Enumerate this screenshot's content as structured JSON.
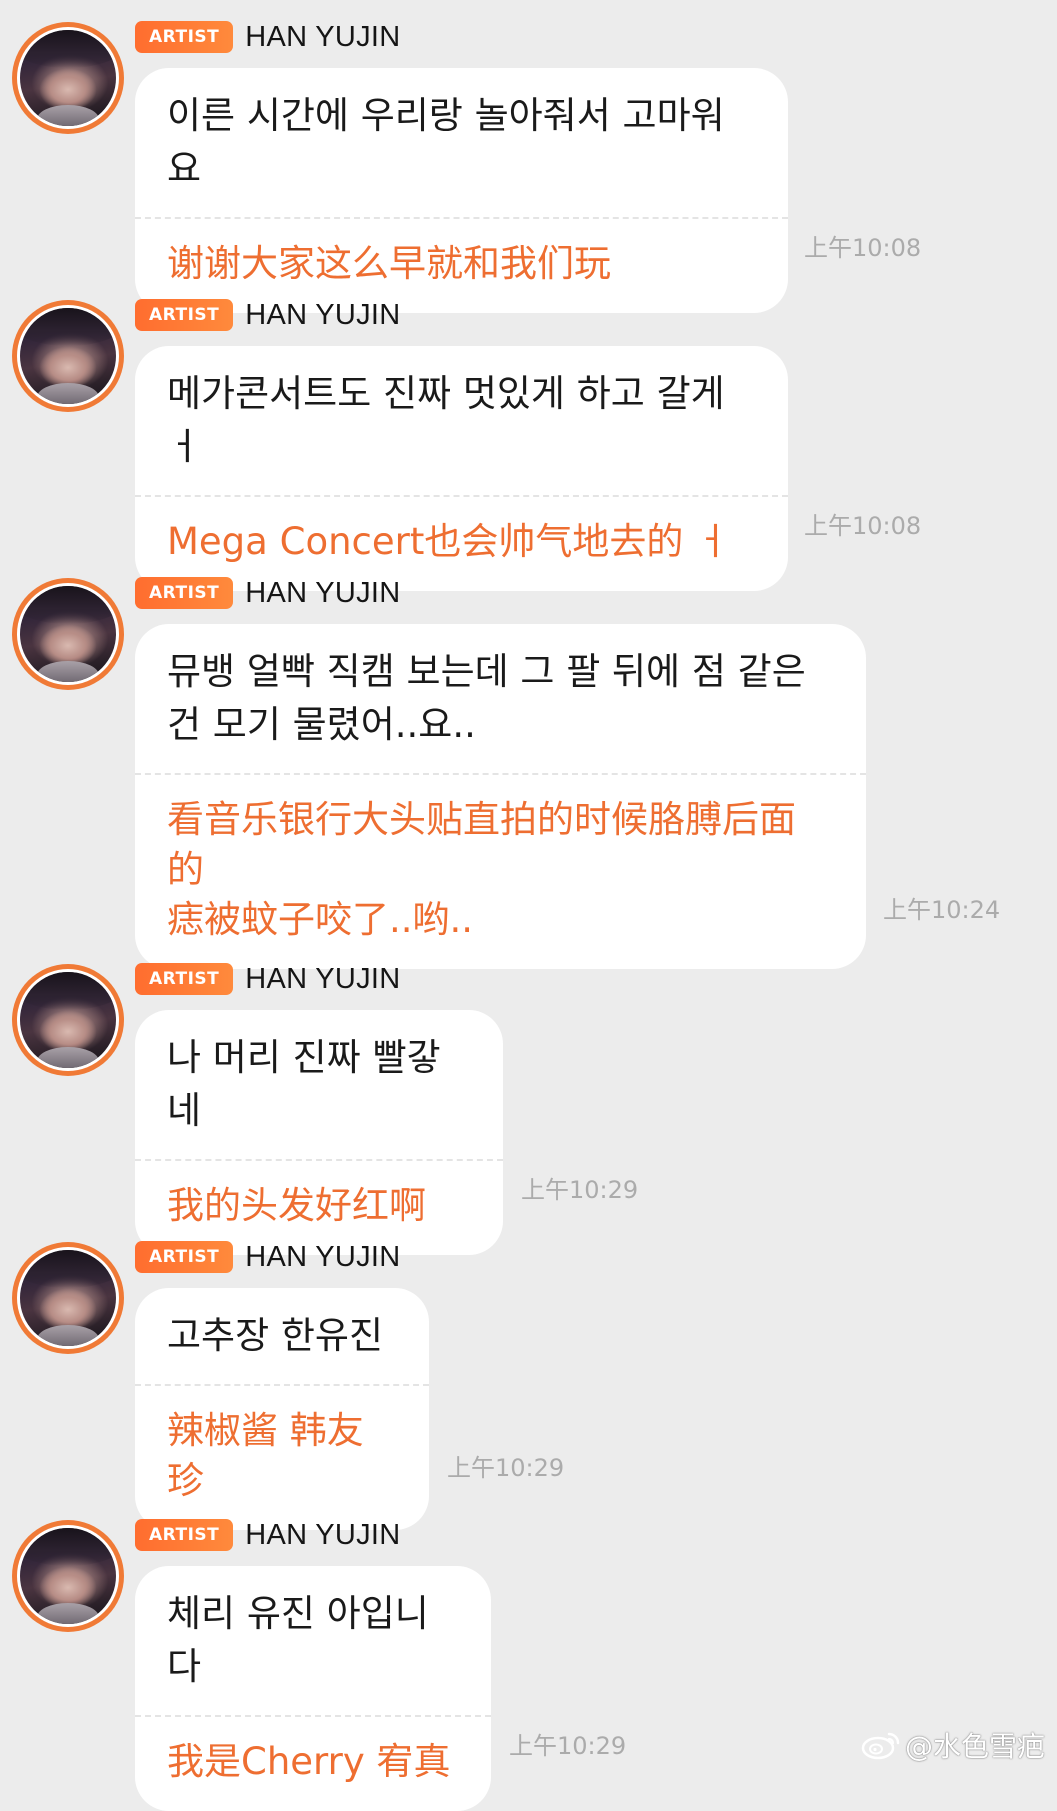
{
  "messages": [
    {
      "badge": "ARTIST",
      "sender": "HAN YUJIN",
      "korean": "이른 시간에 우리랑 놀아줘서 고마워요",
      "chinese": "谢谢大家这么早就和我们玩",
      "time": "上午10:08"
    },
    {
      "badge": "ARTIST",
      "sender": "HAN YUJIN",
      "korean": "메가콘서트도 진짜 멋있게 하고 갈게 ㅓ",
      "chinese": "Mega Concert也会帅气地去的 ㅓ",
      "time": "上午10:08"
    },
    {
      "badge": "ARTIST",
      "sender": "HAN YUJIN",
      "korean": "뮤뱅 얼빡 직캠 보는데 그 팔 뒤에 점 같은\n건 모기 물렸어..요..",
      "chinese": "看音乐银行大头贴直拍的时候胳膊后面的\n痣被蚊子咬了..哟..",
      "time": "上午10:24"
    },
    {
      "badge": "ARTIST",
      "sender": "HAN YUJIN",
      "korean": "나 머리 진짜 빨갛네",
      "chinese": "我的头发好红啊",
      "time": "上午10:29"
    },
    {
      "badge": "ARTIST",
      "sender": "HAN YUJIN",
      "korean": "고추장 한유진",
      "chinese": "辣椒酱 韩友珍",
      "time": "上午10:29"
    },
    {
      "badge": "ARTIST",
      "sender": "HAN YUJIN",
      "korean": "체리 유진 아입니다",
      "chinese": "我是Cherry 宥真",
      "time": "上午10:29"
    }
  ],
  "watermark": {
    "icon": "weibo-icon",
    "text": "@水色雪疤"
  },
  "colors": {
    "background": "#ececec",
    "accent": "#ee6e31",
    "badge": "#ff7a36",
    "timestamp": "#ababab"
  }
}
